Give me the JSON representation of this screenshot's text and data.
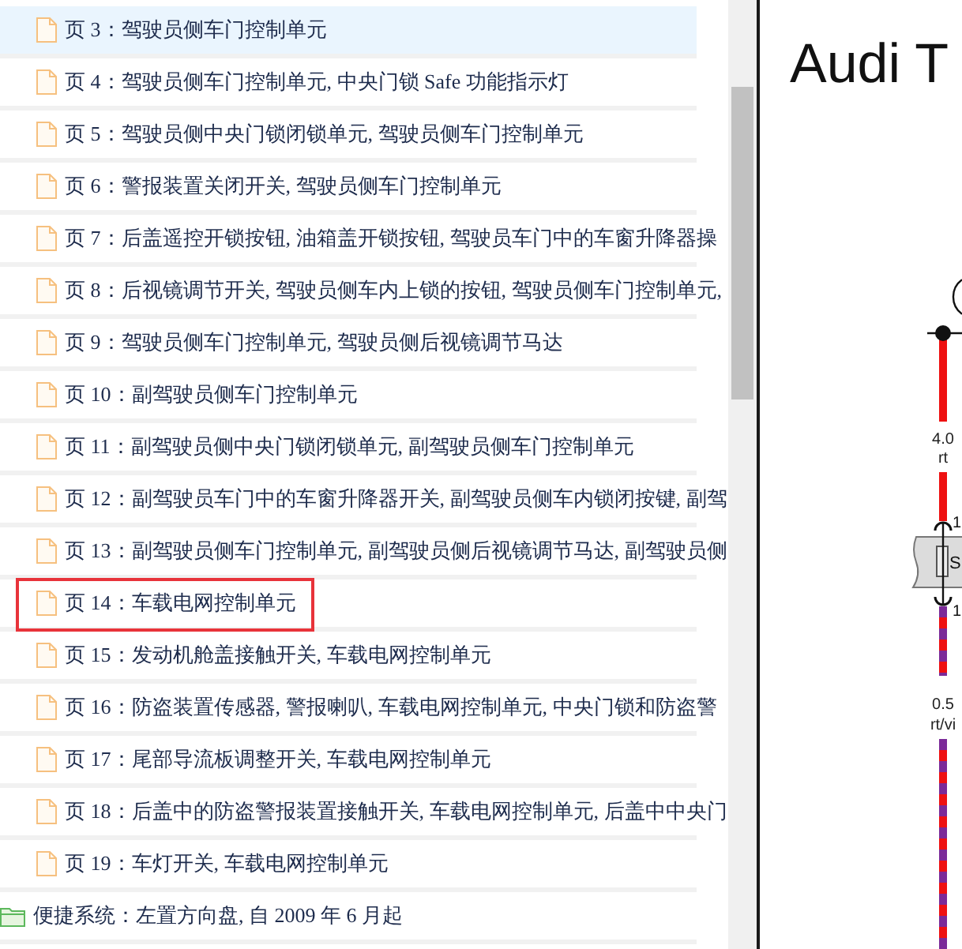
{
  "tree": [
    {
      "children": [
        {
          "kind": "page",
          "label": "页 3：驾驶员侧车门控制单元",
          "selected": true,
          "framed": false
        },
        {
          "kind": "page",
          "label": "页 4：驾驶员侧车门控制单元, 中央门锁 Safe 功能指示灯",
          "selected": false,
          "framed": false
        },
        {
          "kind": "page",
          "label": "页 5：驾驶员侧中央门锁闭锁单元, 驾驶员侧车门控制单元",
          "selected": false,
          "framed": false
        },
        {
          "kind": "page",
          "label": "页 6：警报装置关闭开关, 驾驶员侧车门控制单元",
          "selected": false,
          "framed": false
        },
        {
          "kind": "page",
          "label": "页 7：后盖遥控开锁按钮, 油箱盖开锁按钮, 驾驶员车门中的车窗升降器操",
          "selected": false,
          "framed": false
        },
        {
          "kind": "page",
          "label": "页 8：后视镜调节开关, 驾驶员侧车内上锁的按钮, 驾驶员侧车门控制单元,",
          "selected": false,
          "framed": false
        },
        {
          "kind": "page",
          "label": "页 9：驾驶员侧车门控制单元, 驾驶员侧后视镜调节马达",
          "selected": false,
          "framed": false
        },
        {
          "kind": "page",
          "label": "页 10：副驾驶员侧车门控制单元",
          "selected": false,
          "framed": false
        },
        {
          "kind": "page",
          "label": "页 11：副驾驶员侧中央门锁闭锁单元, 副驾驶员侧车门控制单元",
          "selected": false,
          "framed": false
        },
        {
          "kind": "page",
          "label": "页 12：副驾驶员车门中的车窗升降器开关, 副驾驶员侧车内锁闭按键, 副驾",
          "selected": false,
          "framed": false
        },
        {
          "kind": "page",
          "label": "页 13：副驾驶员侧车门控制单元, 副驾驶员侧后视镜调节马达, 副驾驶员侧",
          "selected": false,
          "framed": false
        },
        {
          "kind": "page",
          "label": "页 14：车载电网控制单元",
          "selected": false,
          "framed": true
        },
        {
          "kind": "page",
          "label": "页 15：发动机舱盖接触开关, 车载电网控制单元",
          "selected": false,
          "framed": false
        },
        {
          "kind": "page",
          "label": "页 16：防盗装置传感器, 警报喇叭, 车载电网控制单元, 中央门锁和防盗警",
          "selected": false,
          "framed": false
        },
        {
          "kind": "page",
          "label": "页 17：尾部导流板调整开关, 车载电网控制单元",
          "selected": false,
          "framed": false
        },
        {
          "kind": "page",
          "label": "页 18：后盖中的防盗警报装置接触开关, 车载电网控制单元, 后盖中中央门",
          "selected": false,
          "framed": false
        },
        {
          "kind": "page",
          "label": "页 19：车灯开关, 车载电网控制单元",
          "selected": false,
          "framed": false
        }
      ]
    },
    {
      "kind": "folder",
      "label": "便捷系统：左置方向盘, 自 2009 年 6 月起",
      "selected": false,
      "framed": false
    }
  ],
  "diagram": {
    "title": "Audi T",
    "wires": [
      {
        "kind": "solid",
        "size": "4.0",
        "color_code": "rt"
      },
      {
        "kind": "striped",
        "size": "0.5",
        "color_code": "rt/vi"
      }
    ],
    "fuse": {
      "label": "S",
      "pins": [
        "1",
        "1"
      ]
    }
  }
}
